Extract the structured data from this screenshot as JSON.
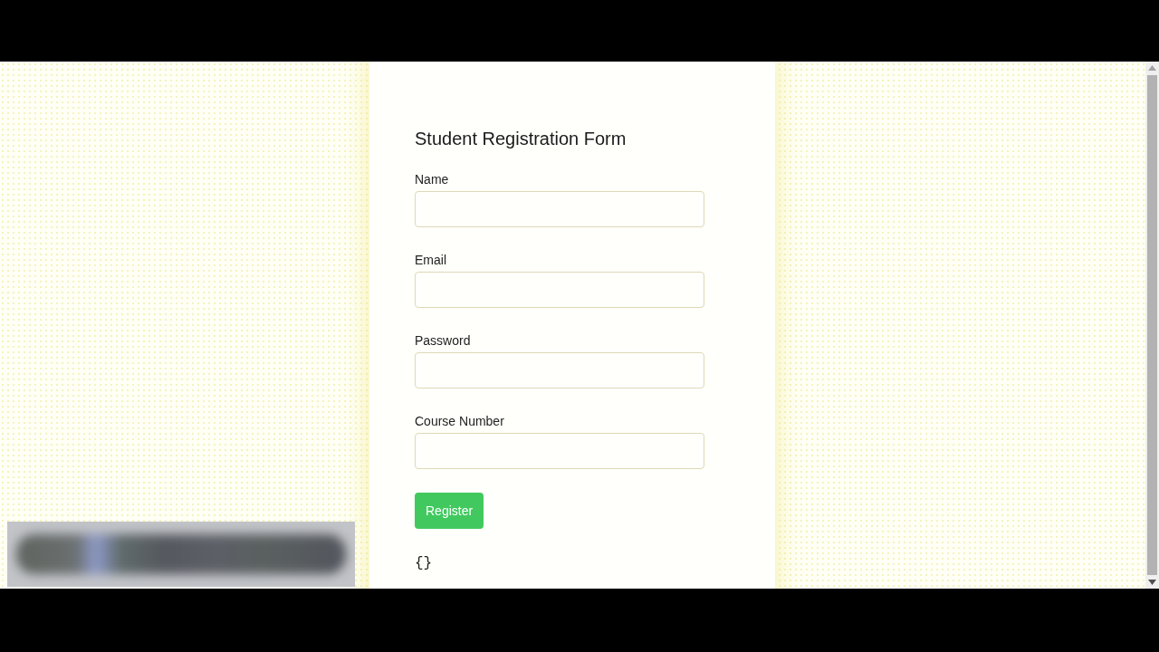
{
  "form": {
    "title": "Student Registration Form",
    "fields": [
      {
        "label": "Name"
      },
      {
        "label": "Email"
      },
      {
        "label": "Password"
      },
      {
        "label": "Course Number"
      }
    ],
    "submit_button": "Register",
    "output": "{}"
  }
}
